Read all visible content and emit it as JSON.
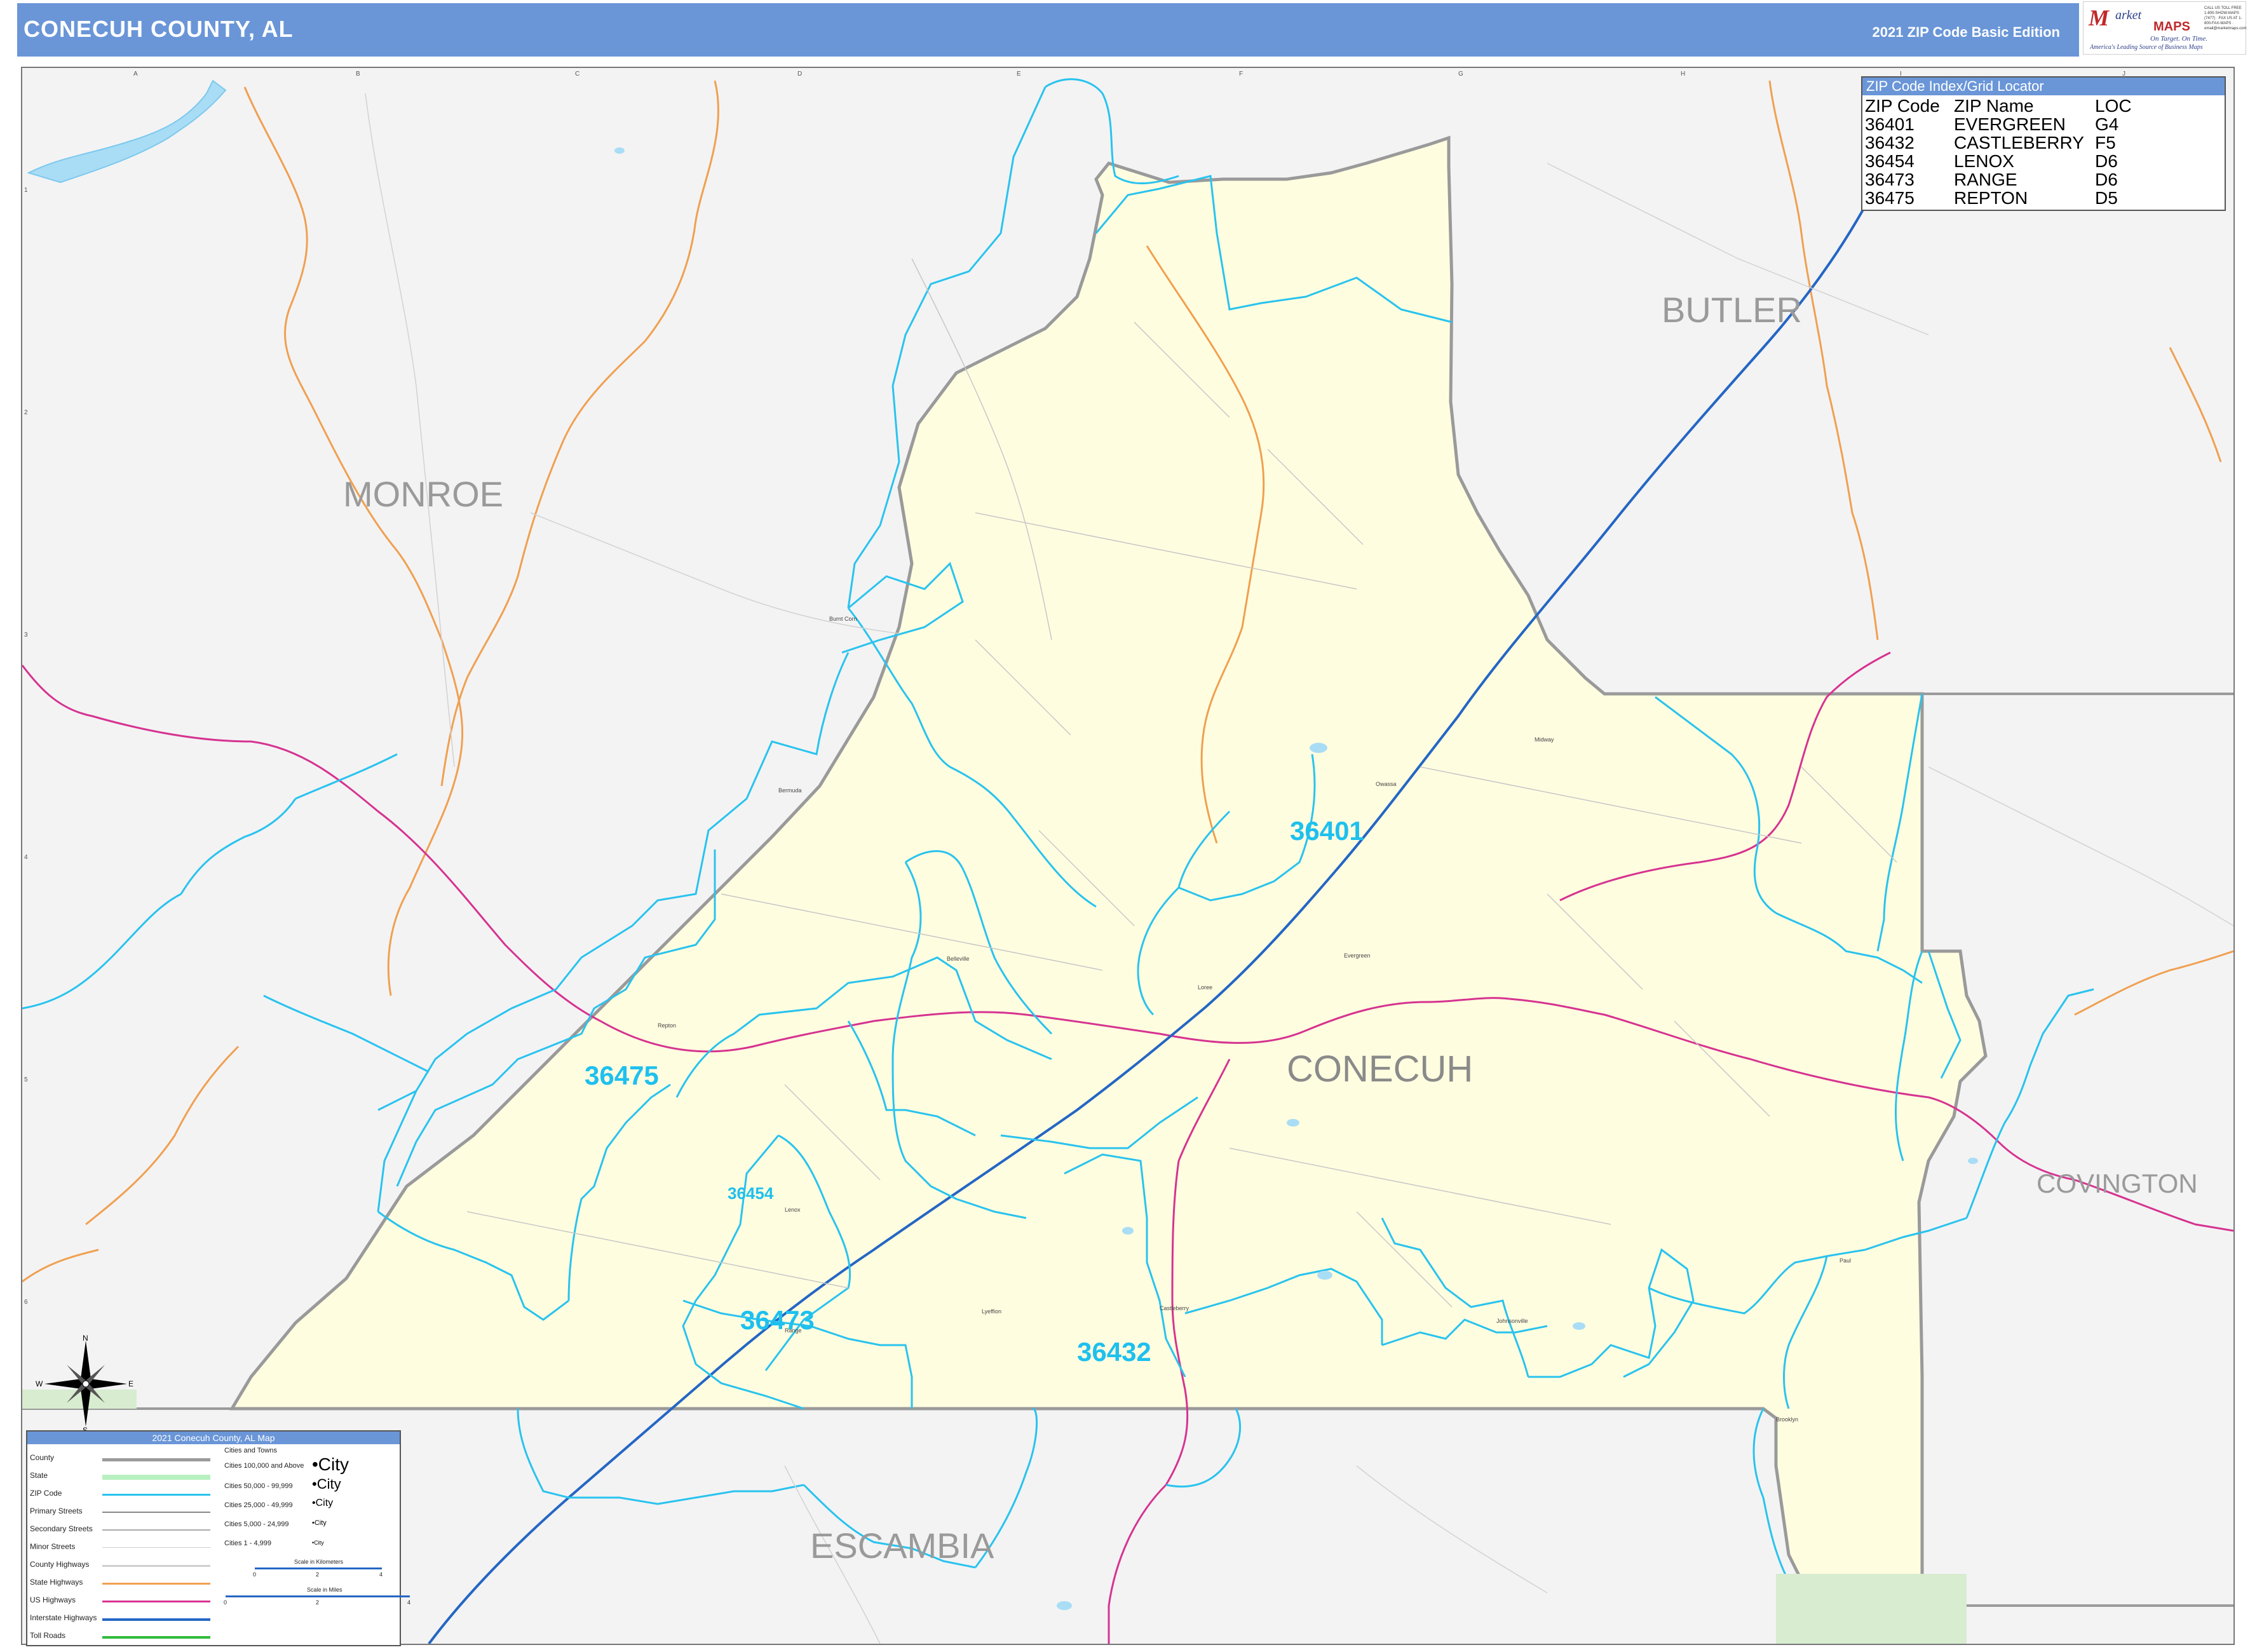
{
  "header": {
    "title": "CONECUH COUNTY, AL",
    "edition": "2021 ZIP Code Basic Edition"
  },
  "logo": {
    "letter": "M",
    "arket": "arket",
    "maps": "MAPS",
    "tagline": "On Target. On Time.",
    "slogan": "America's Leading Source of Business Maps",
    "phone": "CALL US TOLL FREE 1-800-SHOW-MAPS (7477) · FAX US AT 1-800-FAX-MAPS · email@marketmaps.com"
  },
  "grid": {
    "columns": [
      "A",
      "B",
      "C",
      "D",
      "E",
      "F",
      "G",
      "H",
      "I",
      "J"
    ],
    "rows": [
      "1",
      "2",
      "3",
      "4",
      "5",
      "6"
    ]
  },
  "counties": {
    "main": "CONECUH",
    "neighbors": [
      "MONROE",
      "BUTLER",
      "COVINGTON",
      "ESCAMBIA"
    ]
  },
  "zip_labels": [
    "36401",
    "36475",
    "36454",
    "36473",
    "36432"
  ],
  "towns": [
    "Burnt Corn",
    "Bermuda",
    "Evergreen",
    "Owassa",
    "Midway",
    "Castleberry",
    "Johnsonville",
    "Brooklyn",
    "Lenox",
    "Range",
    "Repton",
    "Paul",
    "Loree",
    "Belleville",
    "Lyeffion"
  ],
  "zip_index": {
    "title": "ZIP Code Index/Grid Locator",
    "headers": [
      "ZIP Code",
      "ZIP Name",
      "LOC"
    ],
    "rows": [
      [
        "36401",
        "EVERGREEN",
        "G4"
      ],
      [
        "36432",
        "CASTLEBERRY",
        "F5"
      ],
      [
        "36454",
        "LENOX",
        "D6"
      ],
      [
        "36473",
        "RANGE",
        "D6"
      ],
      [
        "36475",
        "REPTON",
        "D5"
      ]
    ]
  },
  "legend": {
    "title": "2021 Conecuh County, AL Map",
    "items": [
      "County",
      "State",
      "ZIP Code",
      "Primary Streets",
      "Secondary Streets",
      "Minor Streets",
      "County Highways",
      "State Highways",
      "US Highways",
      "Interstate Highways",
      "Toll Roads"
    ],
    "cities_header": "Cities and Towns",
    "cities": [
      {
        "range": "Cities 100,000 and Above",
        "sample": "•City"
      },
      {
        "range": "Cities 50,000 - 99,999",
        "sample": "•City"
      },
      {
        "range": "Cities 25,000 - 49,999",
        "sample": "•City"
      },
      {
        "range": "Cities 5,000 - 24,999",
        "sample": "•City"
      },
      {
        "range": "Cities 1 - 4,999",
        "sample": "•City"
      }
    ],
    "scale_km": "Scale in Kilometers",
    "scale_mi": "Scale in Miles",
    "km_ticks": [
      "0",
      "2",
      "4"
    ],
    "mi_ticks": [
      "0",
      "2",
      "4"
    ]
  },
  "compass": {
    "n": "N",
    "s": "S",
    "e": "E",
    "w": "W"
  },
  "colors": {
    "header": "#6a96d8",
    "county_fill": "#fffde0",
    "zip_line": "#29c3ee",
    "county_line": "#9a9a9a",
    "interstate": "#2466c4",
    "us_highway": "#d63390",
    "state_highway": "#f0a050"
  }
}
